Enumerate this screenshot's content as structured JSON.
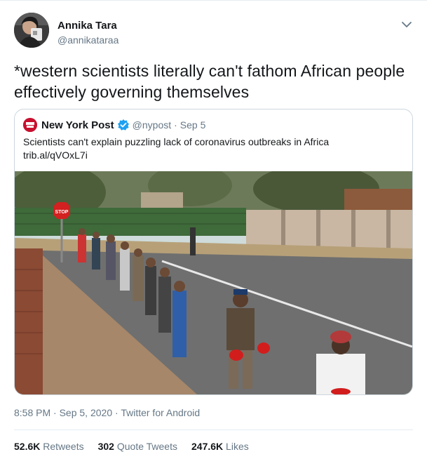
{
  "author": {
    "display_name": "Annika Tara",
    "handle": "@annikataraa"
  },
  "tweet": {
    "text": "*western scientists literally can't fathom African people effectively governing themselves"
  },
  "quoted_tweet": {
    "display_name": "New York Post",
    "verified": true,
    "handle": "@nypost",
    "separator": "·",
    "date": "Sep 5",
    "text": "Scientists can't explain puzzling lack of coronavirus outbreaks in Africa",
    "link": "trib.al/qVOxL7i",
    "image_sign_text": "STOP"
  },
  "meta": {
    "time": "8:58 PM",
    "separator": "·",
    "date": "Sep 5, 2020",
    "client": "Twitter for Android"
  },
  "stats": {
    "retweets_count": "52.6K",
    "retweets_label": "Retweets",
    "quotes_count": "302",
    "quotes_label": "Quote Tweets",
    "likes_count": "247.6K",
    "likes_label": "Likes"
  },
  "colors": {
    "secondary_text": "#657786",
    "primary_text": "#14171a",
    "border": "#ccd6dd",
    "verified_blue": "#1da1f2",
    "nypost_red": "#c8102e"
  },
  "icons": [
    "avatar-photo",
    "chevron-down-icon",
    "nypost-logo",
    "verified-badge-icon"
  ]
}
